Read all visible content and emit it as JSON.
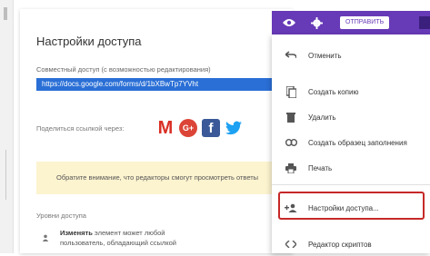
{
  "dialog": {
    "title": "Настройки доступа",
    "share_label": "Совместный доступ (с возможностью редактирования)",
    "link_url": "https://docs.google.com/forms/d/1bXBwTp7YVht",
    "share_via_label": "Поделиться ссылкой через:",
    "social_icons": [
      "gmail-icon",
      "google-plus-icon",
      "facebook-icon",
      "twitter-icon"
    ],
    "notice_text": "Обратите внимание, что редакторы смогут просмотреть ответы",
    "notice_color": "#fcf3cf",
    "access_levels_label": "Уровни доступа",
    "access_entry": {
      "bold": "Изменять",
      "text_line1": " элемент может любой",
      "text_line2": "пользователь, обладающий ссылкой"
    }
  },
  "toolbar": {
    "send_label": "ОТПРАВИТЬ",
    "color": "#673ab7",
    "icons": [
      "eye-icon",
      "gear-icon"
    ]
  },
  "menu": {
    "items": [
      {
        "icon": "undo-icon",
        "label": "Отменить"
      },
      {
        "icon": "copy-icon",
        "label": "Создать копию"
      },
      {
        "icon": "trash-icon",
        "label": "Удалить"
      },
      {
        "icon": "link-icon",
        "label": "Создать образец заполнения"
      },
      {
        "icon": "print-icon",
        "label": "Печать"
      },
      {
        "icon": "add-person-icon",
        "label": "Настройки доступа..."
      },
      {
        "icon": "code-icon",
        "label": "Редактор скриптов"
      }
    ],
    "highlight_color": "#c62828"
  }
}
